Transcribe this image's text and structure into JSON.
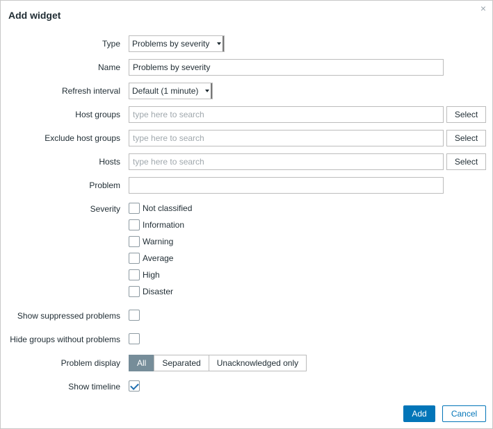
{
  "dialog": {
    "title": "Add widget",
    "close_icon": "close-icon",
    "close_glyph": "×"
  },
  "form": {
    "type": {
      "label": "Type",
      "value": "Problems by severity"
    },
    "name": {
      "label": "Name",
      "value": "Problems by severity"
    },
    "refresh_interval": {
      "label": "Refresh interval",
      "value": "Default (1 minute)"
    },
    "host_groups": {
      "label": "Host groups",
      "placeholder": "type here to search",
      "button": "Select"
    },
    "exclude_host_groups": {
      "label": "Exclude host groups",
      "placeholder": "type here to search",
      "button": "Select"
    },
    "hosts": {
      "label": "Hosts",
      "placeholder": "type here to search",
      "button": "Select"
    },
    "problem": {
      "label": "Problem",
      "value": ""
    },
    "severity": {
      "label": "Severity",
      "options": [
        {
          "label": "Not classified",
          "checked": false
        },
        {
          "label": "Information",
          "checked": false
        },
        {
          "label": "Warning",
          "checked": false
        },
        {
          "label": "Average",
          "checked": false
        },
        {
          "label": "High",
          "checked": false
        },
        {
          "label": "Disaster",
          "checked": false
        }
      ]
    },
    "show_suppressed": {
      "label": "Show suppressed problems",
      "checked": false
    },
    "hide_groups": {
      "label": "Hide groups without problems",
      "checked": false
    },
    "problem_display": {
      "label": "Problem display",
      "options": [
        "All",
        "Separated",
        "Unacknowledged only"
      ],
      "selected": "All"
    },
    "show_timeline": {
      "label": "Show timeline",
      "checked": true
    }
  },
  "footer": {
    "add_label": "Add",
    "cancel_label": "Cancel"
  },
  "colors": {
    "primary": "#0275b8",
    "radio_active": "#768d99",
    "border": "#bcbcbc"
  }
}
